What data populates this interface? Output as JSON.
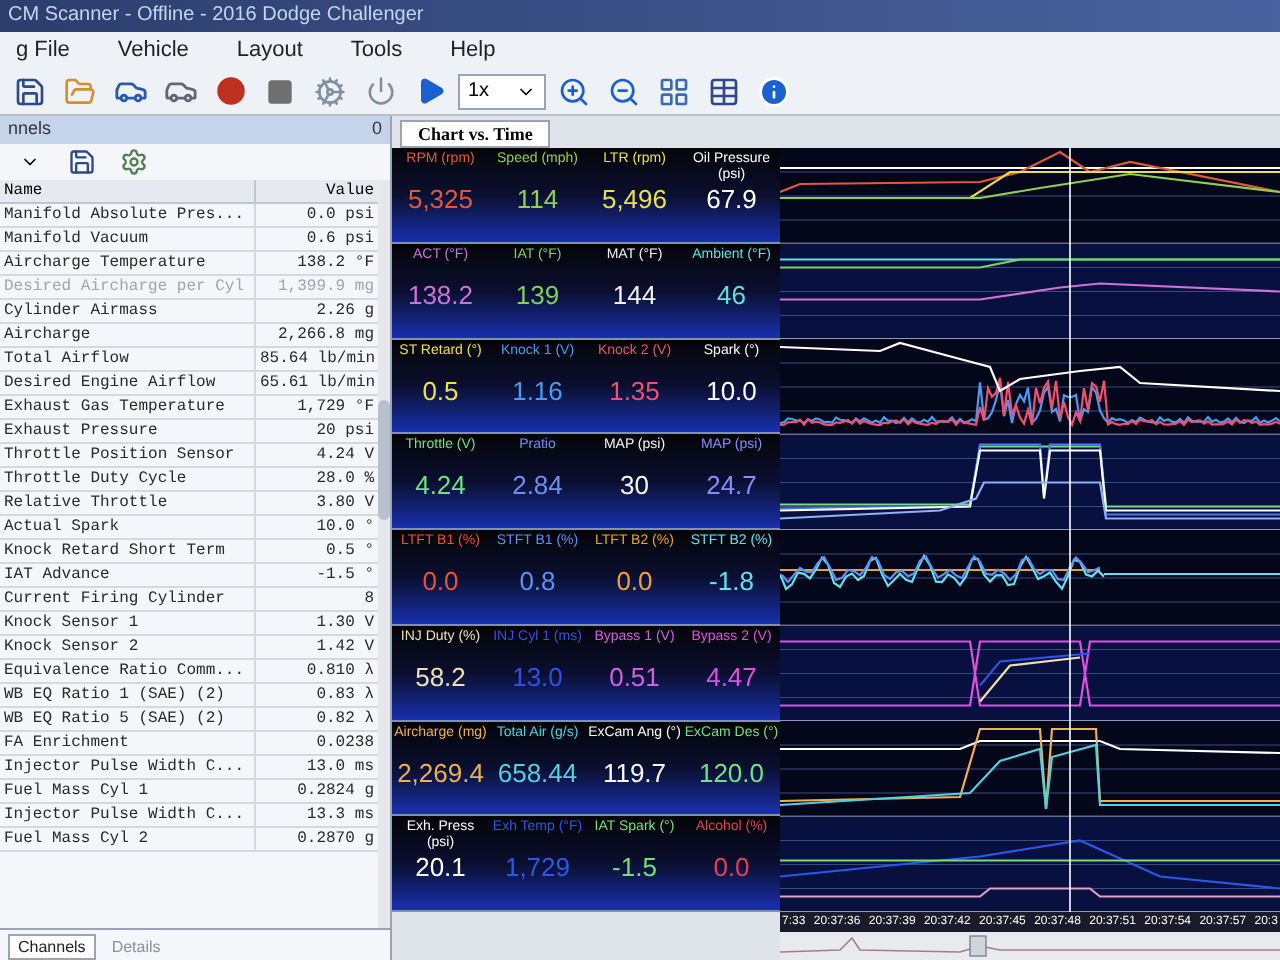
{
  "window": {
    "title": "CM Scanner - Offline - 2016 Dodge Challenger"
  },
  "menu": [
    "g File",
    "Vehicle",
    "Layout",
    "Tools",
    "Help"
  ],
  "toolbar": {
    "speed": "1x"
  },
  "channels_panel": {
    "title": "nnels",
    "count": "0",
    "columns": [
      "Name",
      "Value"
    ],
    "rows": [
      {
        "name": "Manifold Absolute Pres...",
        "value": "0.0 psi",
        "disabled": false
      },
      {
        "name": "Manifold Vacuum",
        "value": "0.6 psi",
        "disabled": false
      },
      {
        "name": "Aircharge Temperature",
        "value": "138.2 °F",
        "disabled": false
      },
      {
        "name": "Desired Aircharge per Cyl",
        "value": "1,399.9 mg",
        "disabled": true
      },
      {
        "name": "Cylinder Airmass",
        "value": "2.26 g",
        "disabled": false
      },
      {
        "name": "Aircharge",
        "value": "2,266.8 mg",
        "disabled": false
      },
      {
        "name": "Total Airflow",
        "value": "85.64 lb/min",
        "disabled": false
      },
      {
        "name": "Desired Engine Airflow",
        "value": "65.61 lb/min",
        "disabled": false
      },
      {
        "name": "Exhaust Gas Temperature",
        "value": "1,729 °F",
        "disabled": false
      },
      {
        "name": "Exhaust Pressure",
        "value": "20 psi",
        "disabled": false
      },
      {
        "name": "Throttle Position Sensor",
        "value": "4.24 V",
        "disabled": false
      },
      {
        "name": "Throttle Duty Cycle",
        "value": "28.0 %",
        "disabled": false
      },
      {
        "name": "Relative Throttle",
        "value": "3.80 V",
        "disabled": false
      },
      {
        "name": "Actual Spark",
        "value": "10.0 °",
        "disabled": false
      },
      {
        "name": "Knock Retard Short Term",
        "value": "0.5 °",
        "disabled": false
      },
      {
        "name": "IAT Advance",
        "value": "-1.5 °",
        "disabled": false
      },
      {
        "name": "Current Firing Cylinder",
        "value": "8",
        "disabled": false
      },
      {
        "name": "Knock Sensor 1",
        "value": "1.30 V",
        "disabled": false
      },
      {
        "name": "Knock Sensor 2",
        "value": "1.42 V",
        "disabled": false
      },
      {
        "name": "Equivalence Ratio Comm...",
        "value": "0.810 λ",
        "disabled": false
      },
      {
        "name": "WB EQ Ratio 1 (SAE) (2)",
        "value": "0.83 λ",
        "disabled": false
      },
      {
        "name": "WB EQ Ratio 5 (SAE) (2)",
        "value": "0.82 λ",
        "disabled": false
      },
      {
        "name": "FA Enrichment",
        "value": "0.0238",
        "disabled": false
      },
      {
        "name": "Injector Pulse Width C...",
        "value": "13.0 ms",
        "disabled": false
      },
      {
        "name": "Fuel Mass Cyl 1",
        "value": "0.2824 g",
        "disabled": false
      },
      {
        "name": "Injector Pulse Width C...",
        "value": "13.3 ms",
        "disabled": false
      },
      {
        "name": "Fuel Mass Cyl 2",
        "value": "0.2870 g",
        "disabled": false
      }
    ],
    "tabs": [
      {
        "label": "Channels",
        "selected": true
      },
      {
        "label": "Details",
        "selected": false
      }
    ]
  },
  "chart_tab": {
    "label": "Chart vs. Time"
  },
  "gauge_rows": [
    {
      "gauges": [
        {
          "label": "RPM (rpm)",
          "value": "5,325",
          "color": "#e05a3a"
        },
        {
          "label": "Speed (mph)",
          "value": "114",
          "color": "#8fd14f"
        },
        {
          "label": "LTR (rpm)",
          "value": "5,496",
          "color": "#e8e04a"
        },
        {
          "label": "Oil Pressure (psi)",
          "value": "67.9",
          "color": "#ffffff"
        }
      ]
    },
    {
      "gauges": [
        {
          "label": "ACT (°F)",
          "value": "138.2",
          "color": "#d070d8"
        },
        {
          "label": "IAT (°F)",
          "value": "139",
          "color": "#7fd05a"
        },
        {
          "label": "MAT (°F)",
          "value": "144",
          "color": "#f0f0f0"
        },
        {
          "label": "Ambient (°F)",
          "value": "46",
          "color": "#5fe0e0"
        }
      ]
    },
    {
      "gauges": [
        {
          "label": "ST Retard (°)",
          "value": "0.5",
          "color": "#f0e040"
        },
        {
          "label": "Knock 1 (V)",
          "value": "1.16",
          "color": "#4a9af0"
        },
        {
          "label": "Knock 2 (V)",
          "value": "1.35",
          "color": "#f05070"
        },
        {
          "label": "Spark (°)",
          "value": "10.0",
          "color": "#fafafa"
        }
      ]
    },
    {
      "gauges": [
        {
          "label": "Throttle (V)",
          "value": "4.24",
          "color": "#70e080"
        },
        {
          "label": "Pratio",
          "value": "2.84",
          "color": "#7090f0"
        },
        {
          "label": "MAP (psi)",
          "value": "30",
          "color": "#f5f5f5"
        },
        {
          "label": "MAP (psi)",
          "value": "24.7",
          "color": "#8090f8"
        }
      ]
    },
    {
      "gauges": [
        {
          "label": "LTFT B1 (%)",
          "value": "0.0",
          "color": "#f05030"
        },
        {
          "label": "STFT B1 (%)",
          "value": "0.8",
          "color": "#6090f0"
        },
        {
          "label": "LTFT B2 (%)",
          "value": "0.0",
          "color": "#f0a030"
        },
        {
          "label": "STFT B2 (%)",
          "value": "-1.8",
          "color": "#60e0f0"
        }
      ]
    },
    {
      "gauges": [
        {
          "label": "INJ Duty (%)",
          "value": "58.2",
          "color": "#f0e0b0"
        },
        {
          "label": "INJ Cyl 1 (ms)",
          "value": "13.0",
          "color": "#3050e8"
        },
        {
          "label": "Bypass 1 (V)",
          "value": "0.51",
          "color": "#d060e0"
        },
        {
          "label": "Bypass 2 (V)",
          "value": "4.47",
          "color": "#e050e0"
        }
      ]
    },
    {
      "gauges": [
        {
          "label": "Aircharge (mg)",
          "value": "2,269.4",
          "color": "#f0b050"
        },
        {
          "label": "Total Air (g/s)",
          "value": "658.44",
          "color": "#50d0e0"
        },
        {
          "label": "ExCam Ang (°)",
          "value": "119.7",
          "color": "#f8f8f8"
        },
        {
          "label": "ExCam Des (°)",
          "value": "120.0",
          "color": "#72e082"
        }
      ]
    },
    {
      "gauges": [
        {
          "label": "Exh. Press (psi)",
          "value": "20.1",
          "color": "#fcfcfc"
        },
        {
          "label": "Exh Temp (°F)",
          "value": "1,729",
          "color": "#2a58e8"
        },
        {
          "label": "IAT Spark (°)",
          "value": "-1.5",
          "color": "#74e074"
        },
        {
          "label": "Alcohol (%)",
          "value": "0.0",
          "color": "#e04050"
        }
      ]
    }
  ],
  "time_labels": [
    "7:33",
    "20:37:36",
    "20:37:39",
    "20:37:42",
    "20:37:45",
    "20:37:48",
    "20:37:51",
    "20:37:54",
    "20:37:57",
    "20:3"
  ]
}
